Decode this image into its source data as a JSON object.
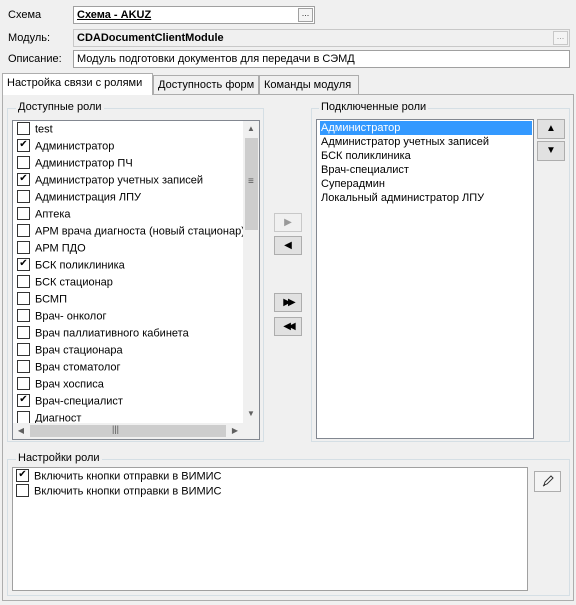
{
  "header": {
    "schema_label": "Схема",
    "schema_value": "Схема - AKUZ",
    "module_label": "Модуль:",
    "module_value": "CDADocumentClientModule",
    "description_label": "Описание:",
    "description_value": "Модуль подготовки документов для передачи в СЭМД",
    "ellipsis": "..."
  },
  "tabs": [
    {
      "label": "Настройка связи с ролями",
      "active": true
    },
    {
      "label": "Доступность форм",
      "active": false
    },
    {
      "label": "Команды модуля",
      "active": false
    }
  ],
  "available_roles": {
    "title": "Доступные роли",
    "items": [
      {
        "label": "test",
        "checked": false
      },
      {
        "label": "Администратор",
        "checked": true
      },
      {
        "label": "Администратор ПЧ",
        "checked": false
      },
      {
        "label": "Администратор учетных записей",
        "checked": true
      },
      {
        "label": "Администрация ЛПУ",
        "checked": false
      },
      {
        "label": "Аптека",
        "checked": false
      },
      {
        "label": "АРМ врача диагноста (новый стационар)",
        "checked": false
      },
      {
        "label": "АРМ ПДО",
        "checked": false
      },
      {
        "label": "БСК поликлиника",
        "checked": true
      },
      {
        "label": "БСК стационар",
        "checked": false
      },
      {
        "label": "БСМП",
        "checked": false
      },
      {
        "label": "Врач- онколог",
        "checked": false
      },
      {
        "label": "Врач паллиативного кабинета",
        "checked": false
      },
      {
        "label": "Врач стационара",
        "checked": false
      },
      {
        "label": "Врач стоматолог",
        "checked": false
      },
      {
        "label": "Врач хосписа",
        "checked": false
      },
      {
        "label": "Врач-специалист",
        "checked": true
      },
      {
        "label": "Диагност",
        "checked": false
      }
    ]
  },
  "move_buttons": {
    "add_one": "▶",
    "remove_one": "◀",
    "add_all": "▶▶",
    "remove_all": "◀◀"
  },
  "connected_roles": {
    "title": "Подключенные роли",
    "items": [
      {
        "label": "Администратор",
        "selected": true
      },
      {
        "label": "Администратор учетных записей",
        "selected": false
      },
      {
        "label": "БСК поликлиника",
        "selected": false
      },
      {
        "label": "Врач-специалист",
        "selected": false
      },
      {
        "label": "Суперадмин",
        "selected": false
      },
      {
        "label": "Локальный администратор ЛПУ",
        "selected": false
      }
    ],
    "up_icon": "▲",
    "down_icon": "▼"
  },
  "role_settings": {
    "title": "Настройки роли",
    "items": [
      {
        "label": "Включить кнопки отправки в ВИМИС",
        "checked": true
      },
      {
        "label": "Включить кнопки отправки в ВИМИС",
        "checked": false
      }
    ],
    "edit_icon": "pencil-icon"
  },
  "scrollbar_glyphs": {
    "up": "▲",
    "down": "▼",
    "left": "◀",
    "right": "▶",
    "grip_v": "≡",
    "grip_h": "|||"
  }
}
